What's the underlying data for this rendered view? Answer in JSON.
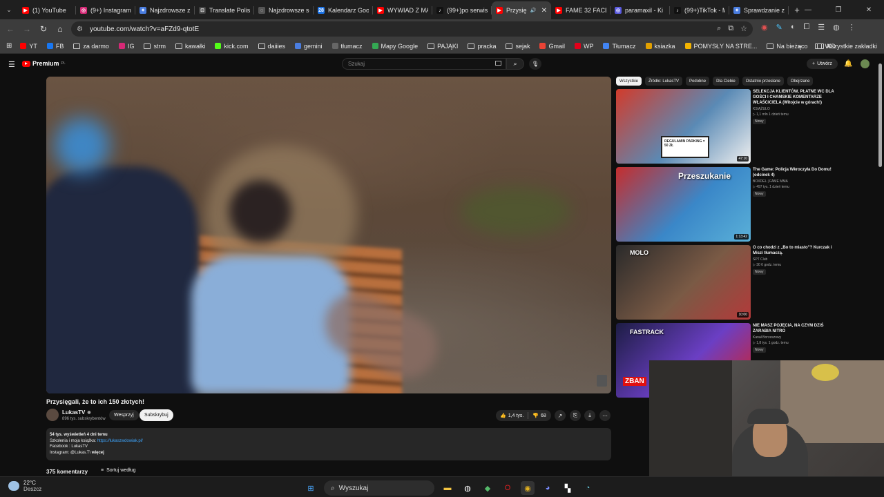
{
  "tabs": [
    {
      "title": "(1) YouTube",
      "color": "#ff0000",
      "glyph": "▶"
    },
    {
      "title": "(9+) Instagram",
      "color": "#d62976",
      "glyph": "◎"
    },
    {
      "title": "Najzdrowsze zi",
      "color": "#4a7de0",
      "glyph": "✦"
    },
    {
      "title": "Translate Polish",
      "color": "#444444",
      "glyph": "⊡"
    },
    {
      "title": "Najzdrowsze sł",
      "color": "#555555",
      "glyph": "◌"
    },
    {
      "title": "Kalendarz Goo",
      "color": "#1a73e8",
      "glyph": "28"
    },
    {
      "title": "WYWIAD Z MA",
      "color": "#ff0000",
      "glyph": "▶"
    },
    {
      "title": "(99+)po serwis",
      "color": "#111111",
      "glyph": "♪"
    },
    {
      "title": "Przysię",
      "color": "#ff0000",
      "glyph": "▶",
      "active": true
    },
    {
      "title": "FAME 32 FACE",
      "color": "#ff0000",
      "glyph": "▶"
    },
    {
      "title": "paramaxil - Ki",
      "color": "#5a5adf",
      "glyph": "◎"
    },
    {
      "title": "(99+)TikTok - M",
      "color": "#111111",
      "glyph": "♪"
    },
    {
      "title": "Sprawdzanie z",
      "color": "#4a7de0",
      "glyph": "✦"
    }
  ],
  "url": "youtube.com/watch?v=aFZd9-qtotE",
  "bookmarks": [
    {
      "label": "YT",
      "color": "#ff0000",
      "type": "icon"
    },
    {
      "label": "FB",
      "color": "#1877f2",
      "type": "icon"
    },
    {
      "label": "za darmo",
      "type": "folder"
    },
    {
      "label": "IG",
      "color": "#d62976",
      "type": "icon"
    },
    {
      "label": "strm",
      "type": "folder"
    },
    {
      "label": "kawałki",
      "type": "folder"
    },
    {
      "label": "kick.com",
      "color": "#53fc18",
      "type": "icon"
    },
    {
      "label": "daiiies",
      "type": "folder"
    },
    {
      "label": "gemini",
      "color": "#4a7de0",
      "type": "icon"
    },
    {
      "label": "tłumacz",
      "color": "#666666",
      "type": "icon"
    },
    {
      "label": "Mapy Google",
      "color": "#34a853",
      "type": "icon"
    },
    {
      "label": "PAJĄKI",
      "type": "folder"
    },
    {
      "label": "pracka",
      "type": "folder"
    },
    {
      "label": "sejak",
      "type": "folder"
    },
    {
      "label": "Gmail",
      "color": "#ea4335",
      "type": "icon"
    },
    {
      "label": "WP",
      "color": "#e2001a",
      "type": "icon"
    },
    {
      "label": "Tłumacz",
      "color": "#4285f4",
      "type": "icon"
    },
    {
      "label": "ksiazka",
      "color": "#e2a000",
      "type": "icon"
    },
    {
      "label": "POMYSŁY NA STRE...",
      "color": "#f4b400",
      "type": "icon"
    },
    {
      "label": "Na bieżąco",
      "type": "folder"
    },
    {
      "label": "AD",
      "type": "folder"
    }
  ],
  "bookmarks_all": "Wszystkie zakładki",
  "yt": {
    "logo_text": "Premium",
    "logo_sup": "PL",
    "search_placeholder": "Szukaj",
    "create_label": "Utwórz"
  },
  "video": {
    "title": "Przysięgali, że to ich 150 złotych!",
    "channel": "LukasTV",
    "subscribers": "896 tys. subskrybentów",
    "join_label": "Wesprzyj",
    "subscribe_label": "Subskrybuj",
    "likes": "1,4 tys.",
    "dislikes": "68"
  },
  "description": {
    "stats": "54 tys. wyświetleń  4 dni temu",
    "line2_prefix": "Szkolenia i moja książka: ",
    "line2_link": "https://lukaszwdowiak.pl/",
    "line3": "Facebook : LukasTV",
    "line4": "Instagram: @Lukas.T\\",
    "more": "więcej"
  },
  "comments": {
    "count_label": "375 komentarzy",
    "sort_label": "Sortuj według"
  },
  "chips": [
    "Wszystkie",
    "Źródło: LukasTV",
    "Podobne",
    "Dla Ciebie",
    "Ostatnio przesłane",
    "Obejrzane"
  ],
  "recommendations": [
    {
      "title": "SELEKCJA KLIENTÓW, PŁATNE WC DLA GOŚCI I CHAMSKIE KOMENTARZE WŁAŚCICIELA (Witojcie w górach!)",
      "channel": "KSIĄŻULO",
      "meta": "▷ 1,1 mln  1 dzień temu",
      "badge": "Nowy",
      "duration": "47:10",
      "sign_text": "REGULAMIN PARKING = 50 ZŁ",
      "thumb_colors": [
        "#d23b2b",
        "#5a8ab5",
        "#f0f0f0"
      ]
    },
    {
      "title": "The Game: Policja Wkroczyła Do Domu! (odcinek 4)",
      "channel": "BOXDEL  |  FAME MMA",
      "meta": "▷ 497 tys.  1 dzień temu",
      "badge": "Nowy",
      "duration": "1:13:42",
      "overlay": "Przeszukanie",
      "thumb_colors": [
        "#c62d2d",
        "#3a87c8",
        "#5ab0d8"
      ]
    },
    {
      "title": "O co chodzi z „Bo to miasto\"? Kurczak i Miszi tłumaczą.",
      "channel": "SPT Club",
      "meta": "▷ 30  6 godz. temu",
      "badge": "Nowy",
      "duration": "10:00",
      "overlay": "MOLO",
      "thumb_colors": [
        "#2a2a2a",
        "#7a5a45",
        "#b33a3a"
      ]
    },
    {
      "title": "NIE MASZ POJĘCIA, NA CZYM DZIŚ ZARABIA NITRO",
      "channel": "Kanał Borzeszowy",
      "meta": "▷ 1,8 tys.  1 godz. temu",
      "badge": "Nowy",
      "overlay": "FASTRACK",
      "overlay2": "ZBAN",
      "thumb_colors": [
        "#1d1d44",
        "#6b3fc4",
        "#d82020"
      ]
    }
  ],
  "taskbar": {
    "temp": "22°C",
    "weather": "Deszcz",
    "search_label": "Wyszukaj"
  }
}
